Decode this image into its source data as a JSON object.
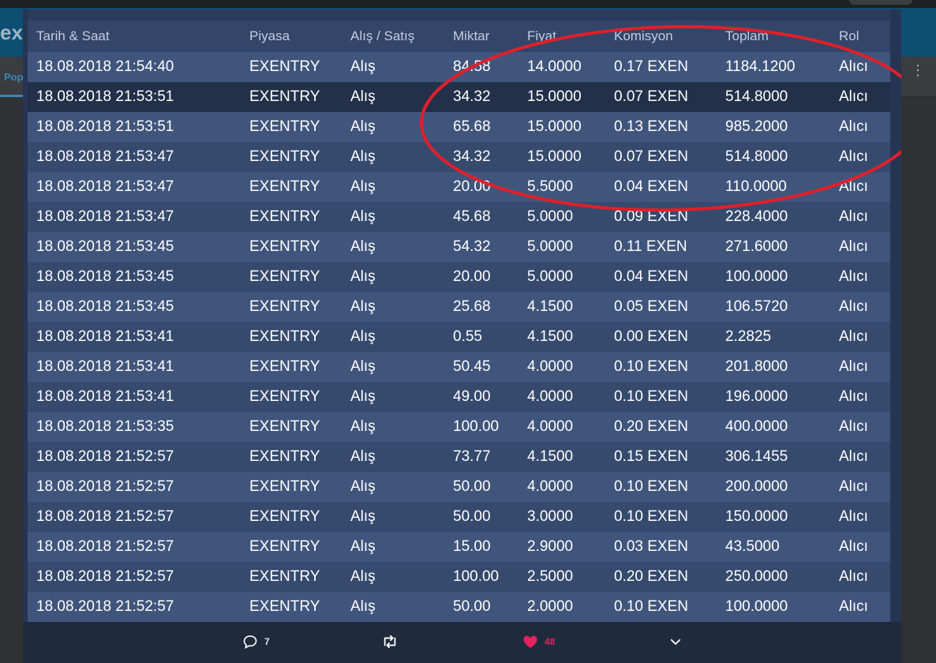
{
  "background": {
    "logo_text": "ex",
    "tab_label": "Pop"
  },
  "table": {
    "headers": [
      "Tarih & Saat",
      "Piyasa",
      "Alış / Satış",
      "Miktar",
      "Fiyat",
      "Komisyon",
      "Toplam",
      "Rol"
    ],
    "rows": [
      [
        "18.08.2018 21:54:40",
        "EXENTRY",
        "Alış",
        "84.58",
        "14.0000",
        "0.17 EXEN",
        "1184.1200",
        "Alıcı"
      ],
      [
        "18.08.2018 21:53:51",
        "EXENTRY",
        "Alış",
        "34.32",
        "15.0000",
        "0.07 EXEN",
        "514.8000",
        "Alıcı"
      ],
      [
        "18.08.2018 21:53:51",
        "EXENTRY",
        "Alış",
        "65.68",
        "15.0000",
        "0.13 EXEN",
        "985.2000",
        "Alıcı"
      ],
      [
        "18.08.2018 21:53:47",
        "EXENTRY",
        "Alış",
        "34.32",
        "15.0000",
        "0.07 EXEN",
        "514.8000",
        "Alıcı"
      ],
      [
        "18.08.2018 21:53:47",
        "EXENTRY",
        "Alış",
        "20.00",
        "5.5000",
        "0.04 EXEN",
        "110.0000",
        "Alıcı"
      ],
      [
        "18.08.2018 21:53:47",
        "EXENTRY",
        "Alış",
        "45.68",
        "5.0000",
        "0.09 EXEN",
        "228.4000",
        "Alıcı"
      ],
      [
        "18.08.2018 21:53:45",
        "EXENTRY",
        "Alış",
        "54.32",
        "5.0000",
        "0.11 EXEN",
        "271.6000",
        "Alıcı"
      ],
      [
        "18.08.2018 21:53:45",
        "EXENTRY",
        "Alış",
        "20.00",
        "5.0000",
        "0.04 EXEN",
        "100.0000",
        "Alıcı"
      ],
      [
        "18.08.2018 21:53:45",
        "EXENTRY",
        "Alış",
        "25.68",
        "4.1500",
        "0.05 EXEN",
        "106.5720",
        "Alıcı"
      ],
      [
        "18.08.2018 21:53:41",
        "EXENTRY",
        "Alış",
        "0.55",
        "4.1500",
        "0.00 EXEN",
        "2.2825",
        "Alıcı"
      ],
      [
        "18.08.2018 21:53:41",
        "EXENTRY",
        "Alış",
        "50.45",
        "4.0000",
        "0.10 EXEN",
        "201.8000",
        "Alıcı"
      ],
      [
        "18.08.2018 21:53:41",
        "EXENTRY",
        "Alış",
        "49.00",
        "4.0000",
        "0.10 EXEN",
        "196.0000",
        "Alıcı"
      ],
      [
        "18.08.2018 21:53:35",
        "EXENTRY",
        "Alış",
        "100.00",
        "4.0000",
        "0.20 EXEN",
        "400.0000",
        "Alıcı"
      ],
      [
        "18.08.2018 21:52:57",
        "EXENTRY",
        "Alış",
        "73.77",
        "4.1500",
        "0.15 EXEN",
        "306.1455",
        "Alıcı"
      ],
      [
        "18.08.2018 21:52:57",
        "EXENTRY",
        "Alış",
        "50.00",
        "4.0000",
        "0.10 EXEN",
        "200.0000",
        "Alıcı"
      ],
      [
        "18.08.2018 21:52:57",
        "EXENTRY",
        "Alış",
        "50.00",
        "3.0000",
        "0.10 EXEN",
        "150.0000",
        "Alıcı"
      ],
      [
        "18.08.2018 21:52:57",
        "EXENTRY",
        "Alış",
        "15.00",
        "2.9000",
        "0.03 EXEN",
        "43.5000",
        "Alıcı"
      ],
      [
        "18.08.2018 21:52:57",
        "EXENTRY",
        "Alış",
        "100.00",
        "2.5000",
        "0.20 EXEN",
        "250.0000",
        "Alıcı"
      ],
      [
        "18.08.2018 21:52:57",
        "EXENTRY",
        "Alış",
        "50.00",
        "2.0000",
        "0.10 EXEN",
        "100.0000",
        "Alıcı"
      ]
    ]
  },
  "actions": {
    "reply_count": "7",
    "retweet_count": "",
    "like_count": "48"
  },
  "colors": {
    "annotation_circle": "#e0202a",
    "like": "#e0245e",
    "header_bg": "#0f4e73",
    "table_bg": "#334568"
  }
}
